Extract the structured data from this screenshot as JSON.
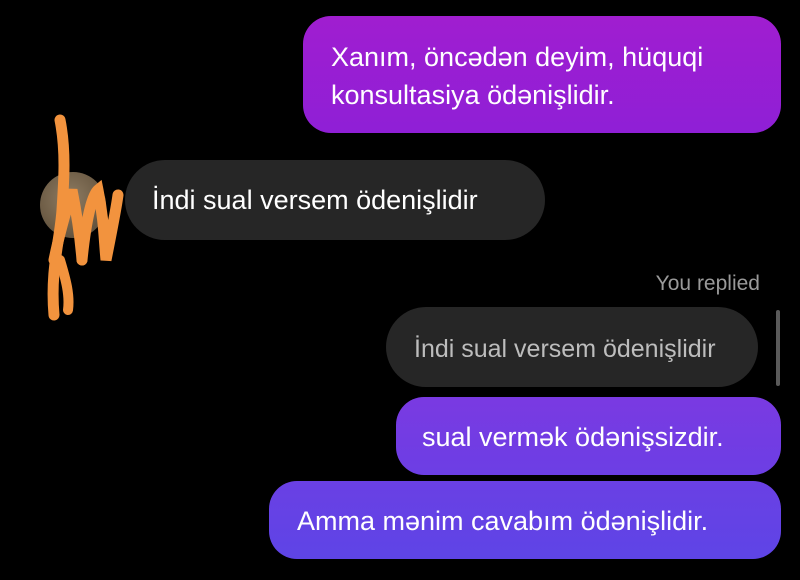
{
  "messages": [
    {
      "direction": "outgoing",
      "lines": [
        "Xanım, öncədən deyim, hüquqi",
        "konsultasiya ödənişlidir."
      ]
    },
    {
      "direction": "incoming",
      "text": "İndi sual versem ödenişlidir",
      "avatar_icon": "avatar-icon"
    },
    {
      "direction": "outgoing",
      "reply_label": "You replied",
      "quoted_text": "İndi sual versem ödenişlidir",
      "text": "sual vermək ödənişsizdir."
    },
    {
      "direction": "outgoing",
      "text": "Amma mənim cavabım ödənişlidir."
    }
  ],
  "colors": {
    "background": "#000000",
    "outgoing_bubble_top": "#a01ed0",
    "outgoing_bubble_bottom": "#5e44e6",
    "incoming_bubble": "#262626",
    "quoted_text": "#bdbdbd",
    "reply_label": "#9a9a9a",
    "scribble": "#f2933e"
  }
}
